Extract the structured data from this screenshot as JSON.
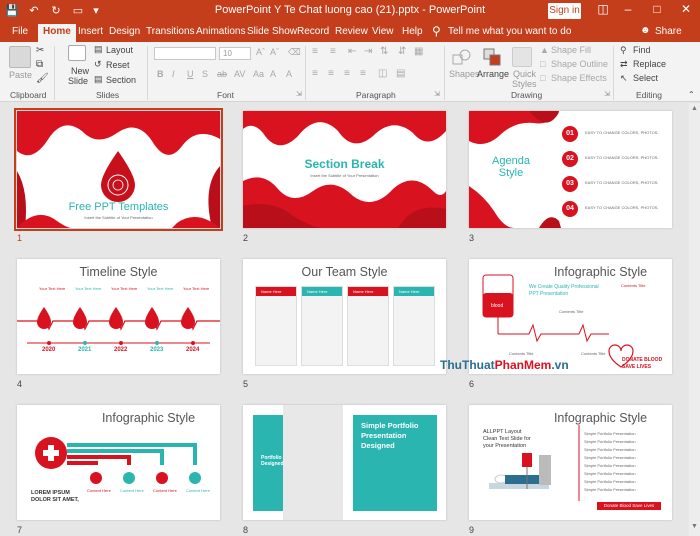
{
  "window": {
    "title": "PowerPoint Y Te Chat luong cao (21).pptx  -  PowerPoint",
    "sign_in": "Sign in"
  },
  "tabs": [
    "File",
    "Home",
    "Insert",
    "Design",
    "Transitions",
    "Animations",
    "Slide Show",
    "Record",
    "Review",
    "View",
    "Help"
  ],
  "tell_me": "Tell me what you want to do",
  "share": "Share",
  "ribbon": {
    "paste": "Paste",
    "clipboard": "Clipboard",
    "new_slide_1": "New",
    "new_slide_2": "Slide",
    "layout": "Layout",
    "reset": "Reset",
    "section": "Section",
    "slides": "Slides",
    "font_size": "10",
    "font_buttons": [
      "B",
      "I",
      "U",
      "S",
      "ab",
      "AV",
      "Aa",
      "A",
      "A"
    ],
    "font": "Font",
    "paragraph": "Paragraph",
    "shapes": "Shapes",
    "arrange": "Arrange",
    "quick_styles_1": "Quick",
    "quick_styles_2": "Styles",
    "shape_fill": "Shape Fill",
    "shape_outline": "Shape Outline",
    "shape_effects": "Shape Effects",
    "drawing": "Drawing",
    "find": "Find",
    "replace": "Replace",
    "select": "Select",
    "editing": "Editing"
  },
  "slides": [
    {
      "number": "1",
      "title": "Free PPT Templates",
      "subtitle": "Insert the Subtitle of Your Presentation",
      "selected": true
    },
    {
      "number": "2",
      "title": "Section Break",
      "subtitle": "Insert the Subtitle of Your Presentation"
    },
    {
      "number": "3",
      "title": "Agenda Style",
      "items": [
        "01",
        "02",
        "03",
        "04"
      ],
      "item_text": "EASY TO CHANGE COLORS, PHOTOS."
    },
    {
      "number": "4",
      "title": "Timeline Style",
      "years": [
        "2020",
        "2021",
        "2022",
        "2023",
        "2024"
      ],
      "item_text": "Your Text Here"
    },
    {
      "number": "5",
      "title": "Our Team Style",
      "item_text": "Name Here"
    },
    {
      "number": "6",
      "title": "Infographic Style",
      "text1": "We Create Quality Professional PPT Presentation",
      "text2": "Contents Title",
      "text3": "DONATE BLOOD SAVE LIVES",
      "badge": "blood"
    },
    {
      "number": "7",
      "title": "Infographic Style",
      "text1": "LOREM IPSUM DOLOR SIT AMET,",
      "item_text": "Content Here"
    },
    {
      "number": "8",
      "title": "Simple Portfolio Presentation Designed",
      "side": "Portfolio Designed"
    },
    {
      "number": "9",
      "title": "Infographic Style",
      "text1": "ALLPPT Layout Clean Text Slide for your Presentation",
      "button": "Donate Blood Save Lives",
      "list": "Simple Portfolio Presentation"
    }
  ],
  "watermark": {
    "part1": "ThuThuat",
    "part2": "PhanMem",
    "part3": ".vn"
  },
  "colors": {
    "accent": "#c43e1c",
    "blood": "#d9121f",
    "teal": "#2bb5b0"
  }
}
